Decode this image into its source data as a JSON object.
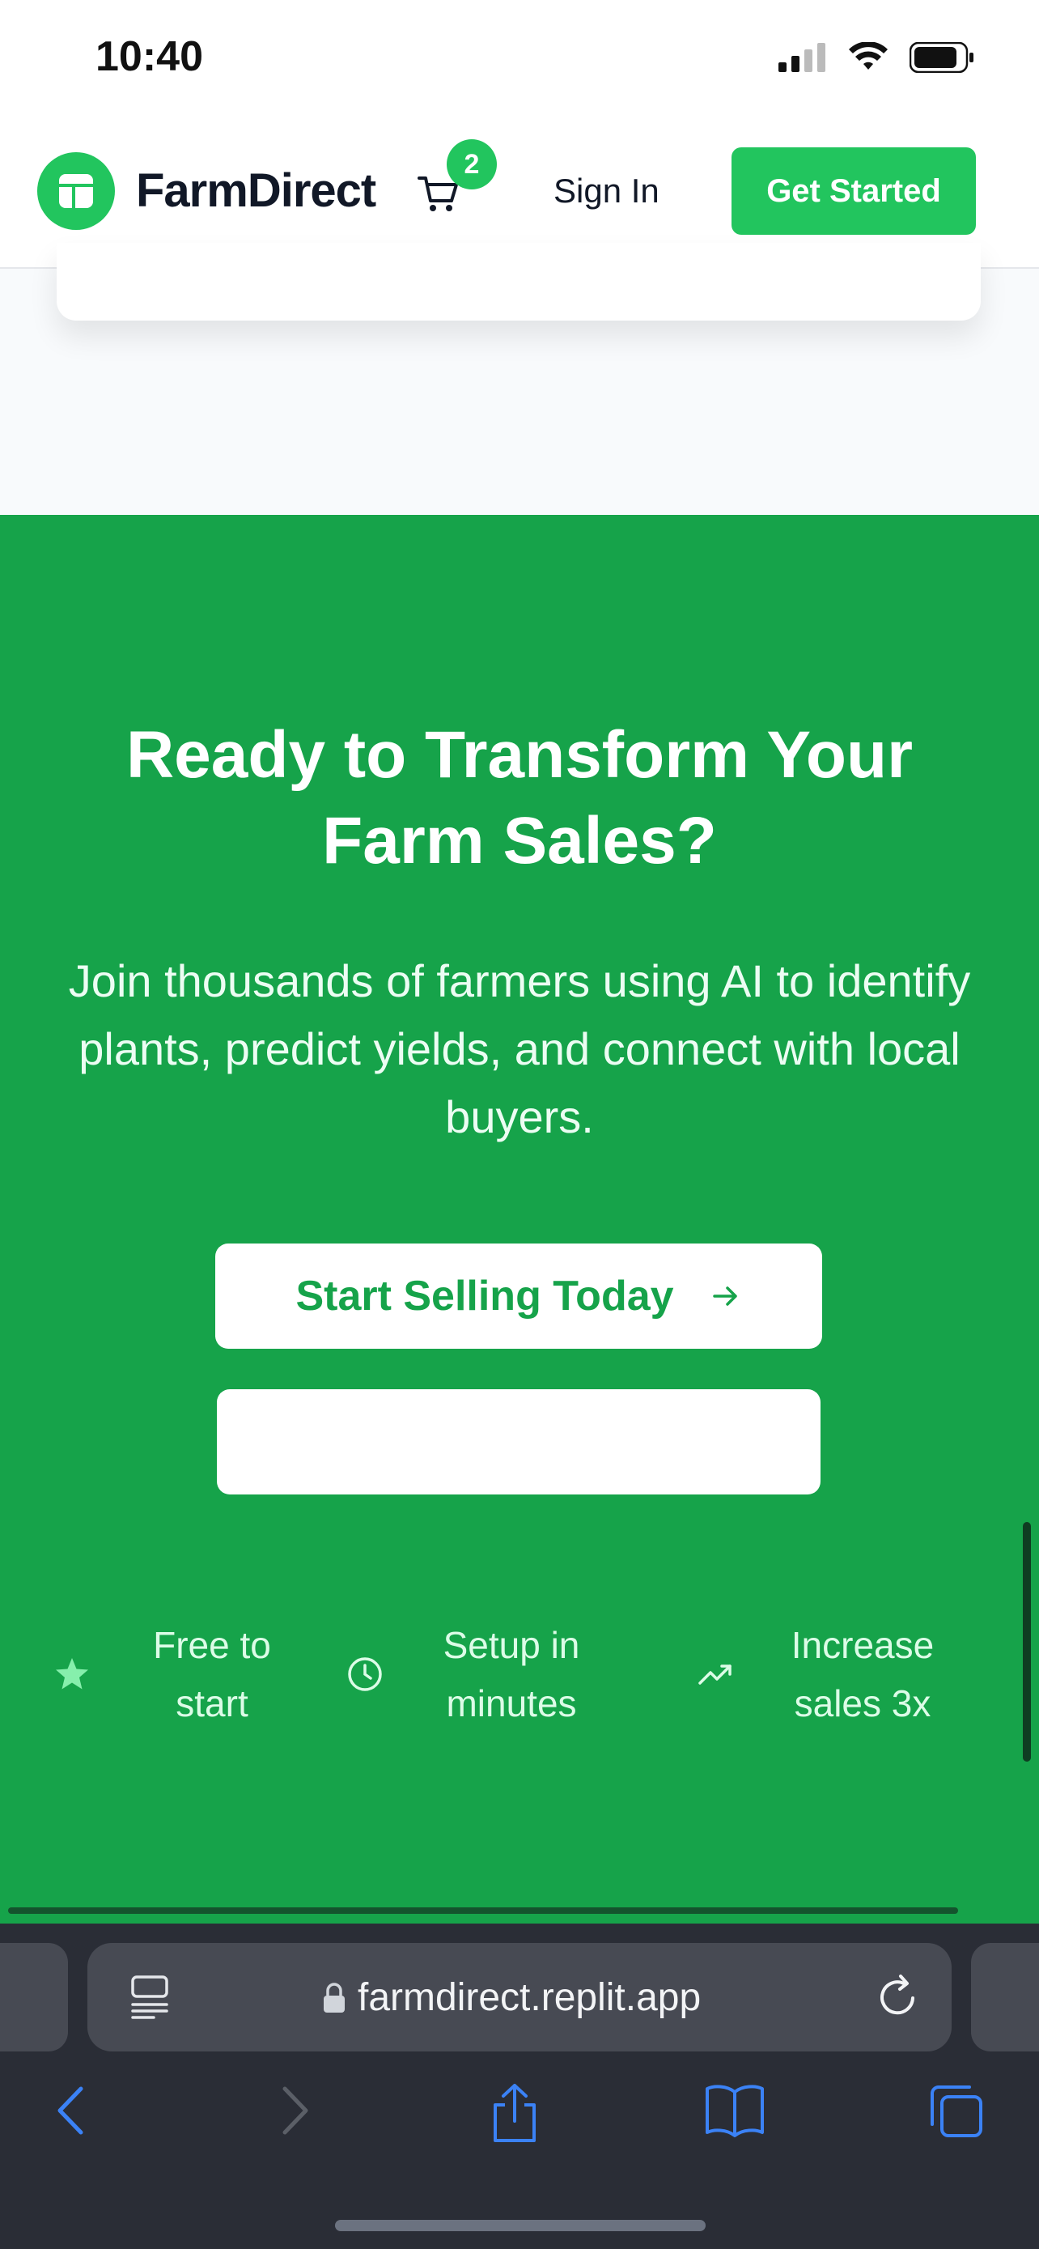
{
  "status_bar": {
    "time": "10:40"
  },
  "header": {
    "brand": "FarmDirect",
    "cart_count": "2",
    "sign_in": "Sign In",
    "get_started": "Get Started"
  },
  "cta": {
    "title": "Ready to Transform Your Farm Sales?",
    "description": "Join thousands of farmers using AI to identify plants, predict yields, and connect with local buyers.",
    "primary_button": "Start Selling Today",
    "secondary_button": "",
    "features": [
      {
        "icon": "star-icon",
        "label": "Free to start"
      },
      {
        "icon": "clock-icon",
        "label": "Setup in minutes"
      },
      {
        "icon": "trending-up-icon",
        "label": "Increase sales 3x"
      }
    ]
  },
  "browser": {
    "url": "farmdirect.replit.app"
  },
  "colors": {
    "brand_green": "#22c55e",
    "section_green": "#16a34a",
    "toolbar_blue": "#3b82f6"
  }
}
